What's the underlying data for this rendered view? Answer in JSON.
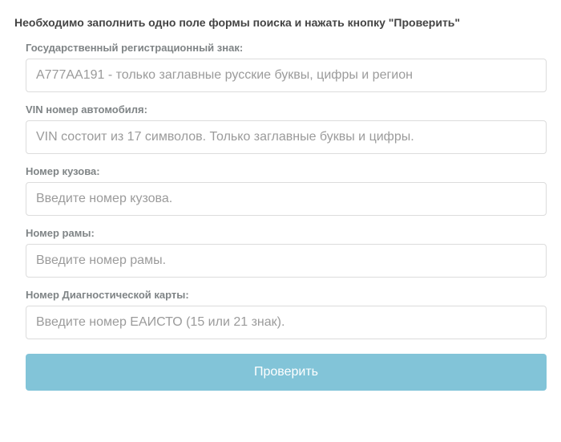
{
  "instruction": "Необходимо заполнить одно поле формы поиска и нажать кнопку \"Проверить\"",
  "fields": {
    "reg": {
      "label": "Государственный регистрационный знак:",
      "placeholder": "А777АА191 - только заглавные русские буквы, цифры и регион"
    },
    "vin": {
      "label": "VIN номер автомобиля:",
      "placeholder": "VIN состоит из 17 символов. Только заглавные буквы и цифры."
    },
    "body": {
      "label": "Номер кузова:",
      "placeholder": "Введите номер кузова."
    },
    "frame": {
      "label": "Номер рамы:",
      "placeholder": "Введите номер рамы."
    },
    "diag": {
      "label": "Номер Диагностической карты:",
      "placeholder": "Введите номер ЕАИСТО (15 или 21 знак)."
    }
  },
  "submit_label": "Проверить"
}
